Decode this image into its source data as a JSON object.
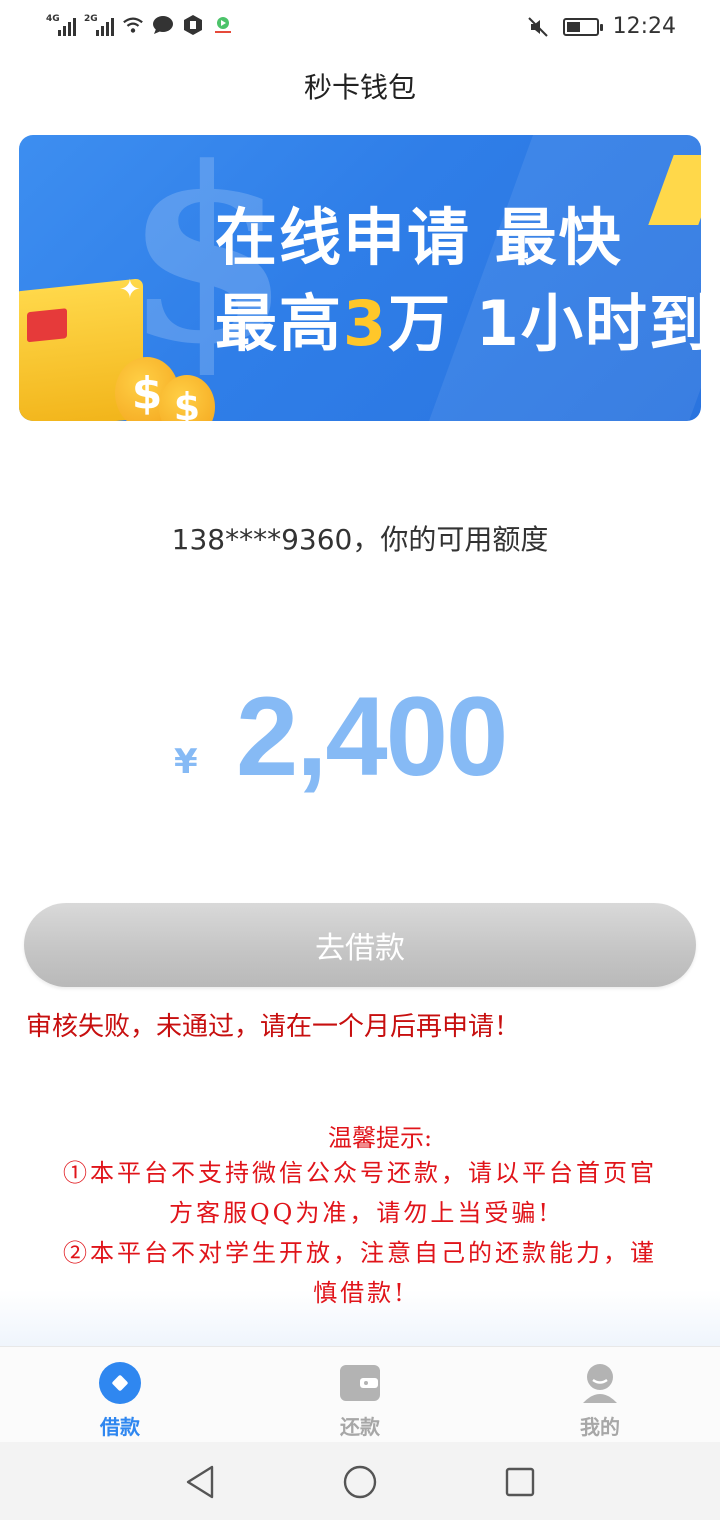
{
  "status_bar": {
    "network1": "4G",
    "network2": "2G",
    "time": "12:24",
    "battery_level": 0.45
  },
  "header": {
    "title": "秒卡钱包"
  },
  "banner": {
    "line1": "在线申请 最快",
    "line2_pre": "最高",
    "line2_highlight": "3",
    "line2_post": "万 1小时到",
    "highlight_color": "#ffc72a"
  },
  "credit": {
    "label": "138****9360，你的可用额度",
    "currency": "¥",
    "amount": "2,400"
  },
  "actions": {
    "borrow_label": "去借款",
    "fail_message": "审核失败，未通过，请在一个月后再申请！"
  },
  "notice": {
    "title": "温馨提示:",
    "line1": "①本平台不支持微信公众号还款，请以平台首页官",
    "line2": "方客服QQ为准，请勿上当受骗!",
    "line3": "②本平台不对学生开放，注意自己的还款能力，谨",
    "line4": "慎借款!"
  },
  "tabs": [
    {
      "label": "借款",
      "icon": "loan-icon",
      "active": true
    },
    {
      "label": "还款",
      "icon": "wallet-icon",
      "active": false
    },
    {
      "label": "我的",
      "icon": "profile-icon",
      "active": false
    }
  ],
  "colors": {
    "accent": "#2f87f0",
    "amount": "#86baf5",
    "error": "#c70f0f"
  }
}
